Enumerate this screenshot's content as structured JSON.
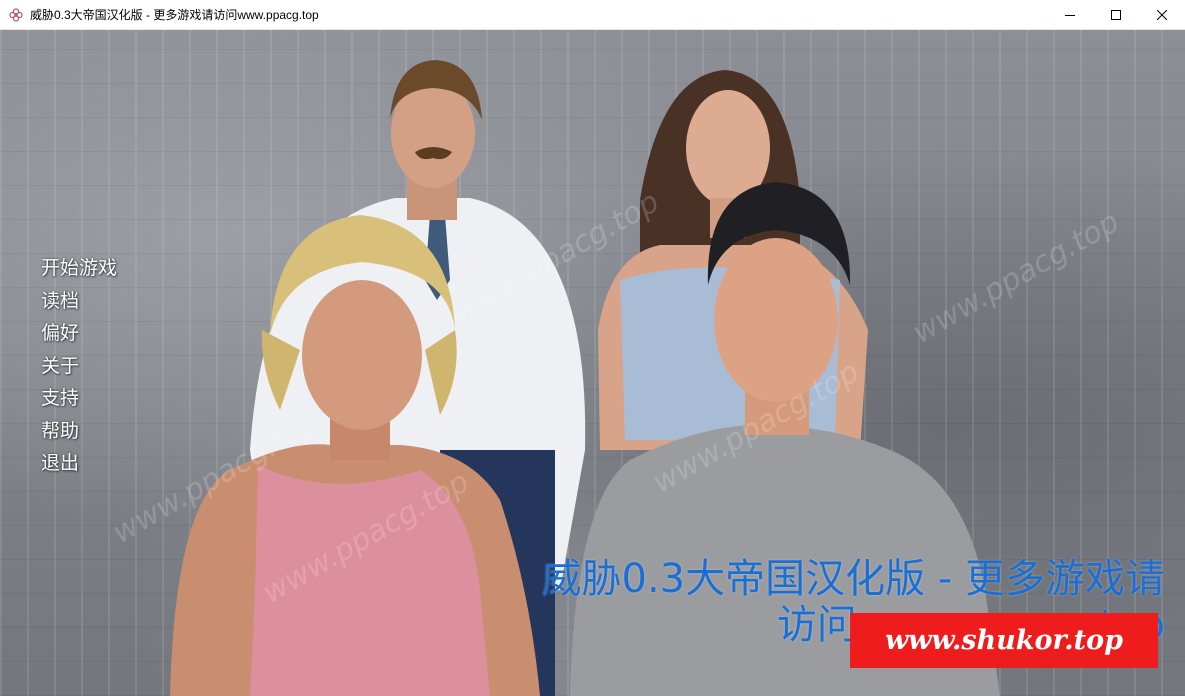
{
  "window": {
    "title": "威胁0.3大帝国汉化版 - 更多游戏请访问www.ppacg.top",
    "icon": "flower-app-icon",
    "controls": [
      "minimize-icon",
      "maximize-icon",
      "close-icon"
    ]
  },
  "main_menu": {
    "items": [
      {
        "label": "开始游戏"
      },
      {
        "label": "读档"
      },
      {
        "label": "偏好"
      },
      {
        "label": "关于"
      },
      {
        "label": "支持"
      },
      {
        "label": "帮助"
      },
      {
        "label": "退出"
      }
    ]
  },
  "overlay": {
    "promo_line1": "威胁0.3大帝国汉化版 - 更多游戏请",
    "promo_line2": "访问www.ppacg.top",
    "badge_text": "www.shukor.top",
    "watermark": "www.ppacg.top"
  },
  "colors": {
    "promo_text": "#1a6fd6",
    "badge_bg": "#ee1c1c",
    "menu_text": "#ffffff"
  }
}
